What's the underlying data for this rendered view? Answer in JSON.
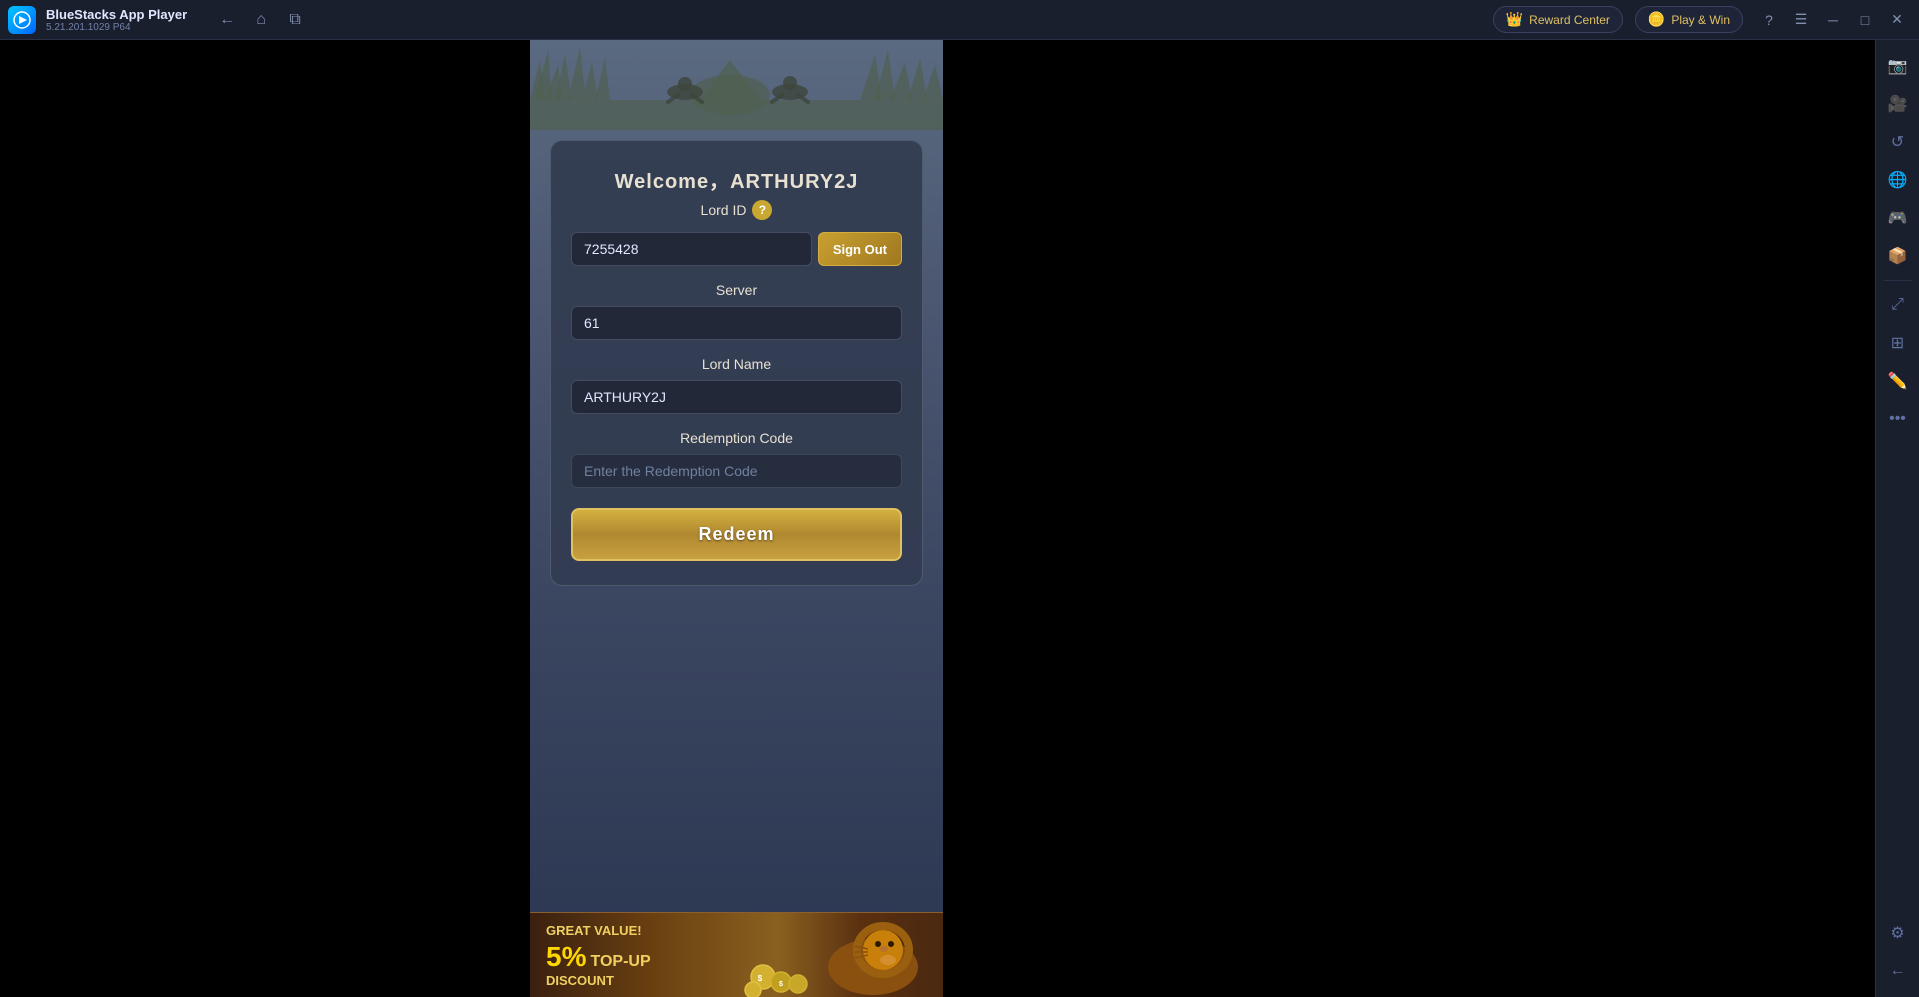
{
  "titlebar": {
    "app_name": "BlueStacks App Player",
    "app_version": "5.21.201.1029  P64",
    "nav": {
      "back_label": "←",
      "home_label": "⌂",
      "multi_label": "⧉"
    },
    "reward_center_label": "Reward Center",
    "play_win_label": "Play & Win",
    "help_label": "?",
    "menu_label": "☰",
    "minimize_label": "─",
    "maximize_label": "□",
    "close_label": "✕"
  },
  "game": {
    "welcome_text": "Welcome，ARTHURY2J",
    "lord_id_label": "Lord ID",
    "lord_id_value": "7255428",
    "sign_out_label": "Sign Out",
    "server_label": "Server",
    "server_value": "61",
    "lord_name_label": "Lord Name",
    "lord_name_value": "ARTHURY2J",
    "redemption_code_label": "Redemption Code",
    "redemption_code_placeholder": "Enter the Redemption Code",
    "redeem_button_label": "Redeem",
    "banner": {
      "great_value": "GREAT VALUE!",
      "percent": "5%",
      "top_up": "TOP-UP",
      "discount": "DISCOUNT"
    }
  },
  "sidebar": {
    "icons": [
      {
        "name": "settings-gear-icon",
        "symbol": "⚙"
      },
      {
        "name": "screenshot-icon",
        "symbol": "📷"
      },
      {
        "name": "rotate-icon",
        "symbol": "↺"
      },
      {
        "name": "globe-icon",
        "symbol": "🌐"
      },
      {
        "name": "gamepad-icon",
        "symbol": "🎮"
      },
      {
        "name": "apk-icon",
        "symbol": "📦"
      },
      {
        "name": "resize-icon",
        "symbol": "⤢"
      },
      {
        "name": "apps-icon",
        "symbol": "⊞"
      },
      {
        "name": "more-icon",
        "symbol": "•••"
      },
      {
        "name": "settings-bottom-icon",
        "symbol": "⚙"
      },
      {
        "name": "back-bottom-icon",
        "symbol": "←"
      }
    ]
  }
}
